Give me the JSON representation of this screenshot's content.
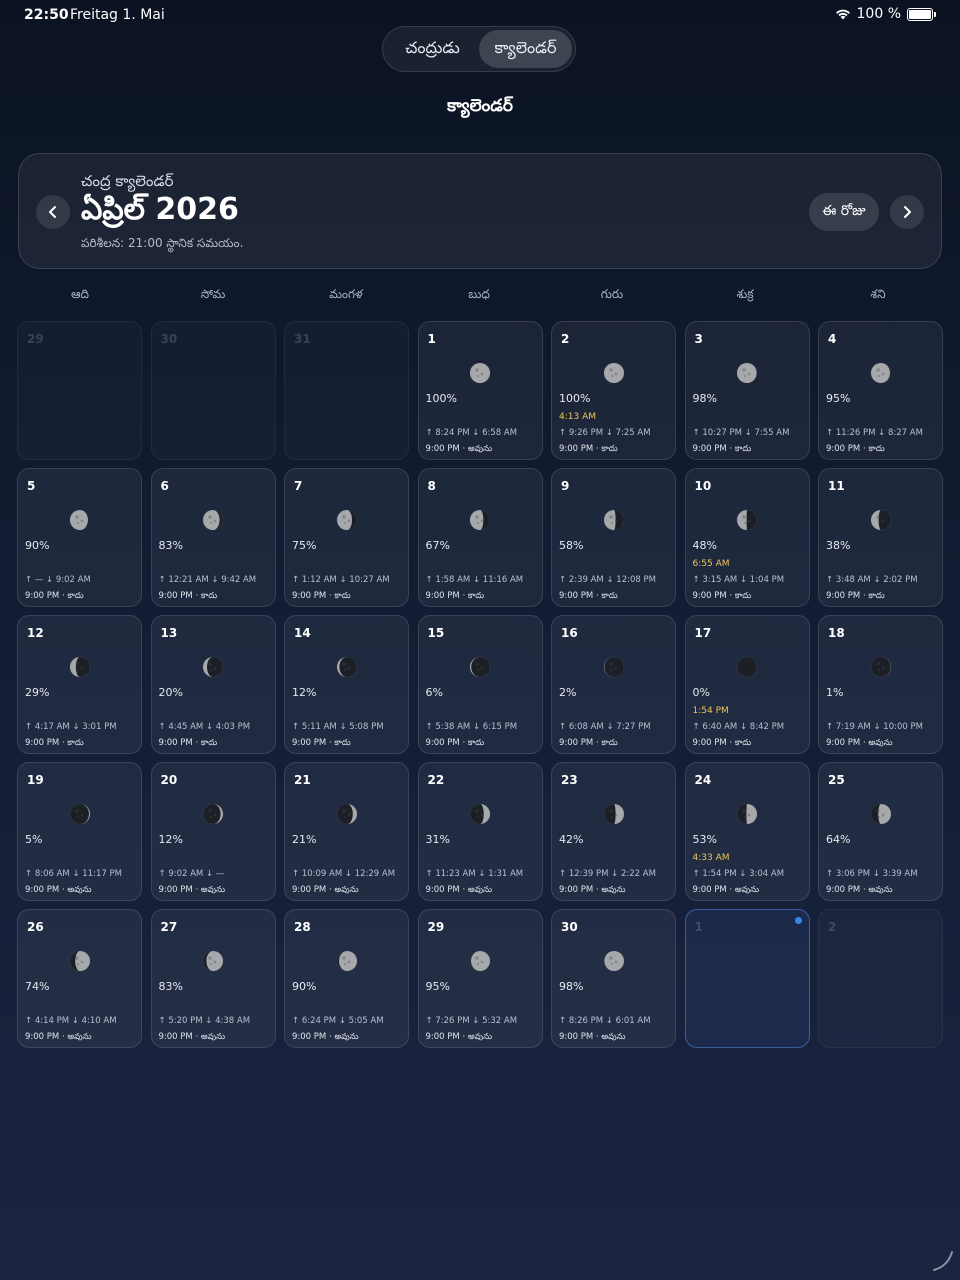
{
  "status": {
    "time": "22:50",
    "date": "Freitag 1. Mai",
    "battery": "100 %"
  },
  "segments": [
    {
      "label": "చంద్రుడు",
      "active": false
    },
    {
      "label": "క్యాలెండర్",
      "active": true
    }
  ],
  "page_title": "క్యాలెండర్",
  "header": {
    "subtitle": "చంద్ర క్యాలెండర్",
    "title": "ఏప్రిల్ 2026",
    "note": "పరిశీలన: 21:00 స్థానిక సమయం.",
    "today_label": "ఈ రోజు"
  },
  "weekdays": [
    "ఆది",
    "సోమ",
    "మంగళ",
    "బుధ",
    "గురు",
    "శుక్ర",
    "శని"
  ],
  "days": [
    {
      "day": "29",
      "dim": true
    },
    {
      "day": "30",
      "dim": true
    },
    {
      "day": "31",
      "dim": true
    },
    {
      "day": "1",
      "pct": "100%",
      "illum": 1.0,
      "waxing": false,
      "rise": "↑ 8:24 PM  ↓ 6:58 AM",
      "obs": "9:00 PM · అవును"
    },
    {
      "day": "2",
      "pct": "100%",
      "illum": 1.0,
      "waxing": false,
      "event": "4:13 AM",
      "rise": "↑ 9:26 PM  ↓ 7:25 AM",
      "obs": "9:00 PM · కాదు"
    },
    {
      "day": "3",
      "pct": "98%",
      "illum": 0.98,
      "waxing": false,
      "rise": "↑ 10:27 PM  ↓ 7:55 AM",
      "obs": "9:00 PM · కాదు"
    },
    {
      "day": "4",
      "pct": "95%",
      "illum": 0.95,
      "waxing": false,
      "rise": "↑ 11:26 PM  ↓ 8:27 AM",
      "obs": "9:00 PM · కాదు"
    },
    {
      "day": "5",
      "pct": "90%",
      "illum": 0.9,
      "waxing": false,
      "rise": "↑ —  ↓ 9:02 AM",
      "obs": "9:00 PM · కాదు"
    },
    {
      "day": "6",
      "pct": "83%",
      "illum": 0.83,
      "waxing": false,
      "rise": "↑ 12:21 AM  ↓ 9:42 AM",
      "obs": "9:00 PM · కాదు"
    },
    {
      "day": "7",
      "pct": "75%",
      "illum": 0.75,
      "waxing": false,
      "rise": "↑ 1:12 AM  ↓ 10:27 AM",
      "obs": "9:00 PM · కాదు"
    },
    {
      "day": "8",
      "pct": "67%",
      "illum": 0.67,
      "waxing": false,
      "rise": "↑ 1:58 AM  ↓ 11:16 AM",
      "obs": "9:00 PM · కాదు"
    },
    {
      "day": "9",
      "pct": "58%",
      "illum": 0.58,
      "waxing": false,
      "rise": "↑ 2:39 AM  ↓ 12:08 PM",
      "obs": "9:00 PM · కాదు"
    },
    {
      "day": "10",
      "pct": "48%",
      "illum": 0.48,
      "waxing": false,
      "event": "6:55 AM",
      "rise": "↑ 3:15 AM  ↓ 1:04 PM",
      "obs": "9:00 PM · కాదు"
    },
    {
      "day": "11",
      "pct": "38%",
      "illum": 0.38,
      "waxing": false,
      "rise": "↑ 3:48 AM  ↓ 2:02 PM",
      "obs": "9:00 PM · కాదు"
    },
    {
      "day": "12",
      "pct": "29%",
      "illum": 0.29,
      "waxing": false,
      "rise": "↑ 4:17 AM  ↓ 3:01 PM",
      "obs": "9:00 PM · కాదు"
    },
    {
      "day": "13",
      "pct": "20%",
      "illum": 0.2,
      "waxing": false,
      "rise": "↑ 4:45 AM  ↓ 4:03 PM",
      "obs": "9:00 PM · కాదు"
    },
    {
      "day": "14",
      "pct": "12%",
      "illum": 0.12,
      "waxing": false,
      "rise": "↑ 5:11 AM  ↓ 5:08 PM",
      "obs": "9:00 PM · కాదు"
    },
    {
      "day": "15",
      "pct": "6%",
      "illum": 0.06,
      "waxing": false,
      "rise": "↑ 5:38 AM  ↓ 6:15 PM",
      "obs": "9:00 PM · కాదు"
    },
    {
      "day": "16",
      "pct": "2%",
      "illum": 0.02,
      "waxing": false,
      "rise": "↑ 6:08 AM  ↓ 7:27 PM",
      "obs": "9:00 PM · కాదు"
    },
    {
      "day": "17",
      "pct": "0%",
      "illum": 0.0,
      "waxing": true,
      "event": "1:54 PM",
      "rise": "↑ 6:40 AM  ↓ 8:42 PM",
      "obs": "9:00 PM · కాదు"
    },
    {
      "day": "18",
      "pct": "1%",
      "illum": 0.01,
      "waxing": true,
      "rise": "↑ 7:19 AM  ↓ 10:00 PM",
      "obs": "9:00 PM · అవును"
    },
    {
      "day": "19",
      "pct": "5%",
      "illum": 0.05,
      "waxing": true,
      "rise": "↑ 8:06 AM  ↓ 11:17 PM",
      "obs": "9:00 PM · అవును"
    },
    {
      "day": "20",
      "pct": "12%",
      "illum": 0.12,
      "waxing": true,
      "rise": "↑ 9:02 AM  ↓ —",
      "obs": "9:00 PM · అవును"
    },
    {
      "day": "21",
      "pct": "21%",
      "illum": 0.21,
      "waxing": true,
      "rise": "↑ 10:09 AM  ↓ 12:29 AM",
      "obs": "9:00 PM · అవును"
    },
    {
      "day": "22",
      "pct": "31%",
      "illum": 0.31,
      "waxing": true,
      "rise": "↑ 11:23 AM  ↓ 1:31 AM",
      "obs": "9:00 PM · అవును"
    },
    {
      "day": "23",
      "pct": "42%",
      "illum": 0.42,
      "waxing": true,
      "rise": "↑ 12:39 PM  ↓ 2:22 AM",
      "obs": "9:00 PM · అవును"
    },
    {
      "day": "24",
      "pct": "53%",
      "illum": 0.53,
      "waxing": true,
      "event": "4:33 AM",
      "rise": "↑ 1:54 PM  ↓ 3:04 AM",
      "obs": "9:00 PM · అవును"
    },
    {
      "day": "25",
      "pct": "64%",
      "illum": 0.64,
      "waxing": true,
      "rise": "↑ 3:06 PM  ↓ 3:39 AM",
      "obs": "9:00 PM · అవును"
    },
    {
      "day": "26",
      "pct": "74%",
      "illum": 0.74,
      "waxing": true,
      "rise": "↑ 4:14 PM  ↓ 4:10 AM",
      "obs": "9:00 PM · అవును"
    },
    {
      "day": "27",
      "pct": "83%",
      "illum": 0.83,
      "waxing": true,
      "rise": "↑ 5:20 PM  ↓ 4:38 AM",
      "obs": "9:00 PM · అవును"
    },
    {
      "day": "28",
      "pct": "90%",
      "illum": 0.9,
      "waxing": true,
      "rise": "↑ 6:24 PM  ↓ 5:05 AM",
      "obs": "9:00 PM · అవును"
    },
    {
      "day": "29",
      "pct": "95%",
      "illum": 0.95,
      "waxing": true,
      "rise": "↑ 7:26 PM  ↓ 5:32 AM",
      "obs": "9:00 PM · అవును"
    },
    {
      "day": "30",
      "pct": "98%",
      "illum": 0.98,
      "waxing": true,
      "rise": "↑ 8:26 PM  ↓ 6:01 AM",
      "obs": "9:00 PM · అవును"
    },
    {
      "day": "1",
      "dim": true,
      "selected": true
    },
    {
      "day": "2",
      "dim": true
    }
  ],
  "colors": {
    "accent": "#3a86e8",
    "event": "#f2c35c",
    "background": "#121d33"
  },
  "icons": {
    "prev": "chevron-left-icon",
    "next": "chevron-right-icon",
    "wifi": "wifi-icon",
    "battery": "battery-icon",
    "moon": "moon-phase-icon"
  }
}
